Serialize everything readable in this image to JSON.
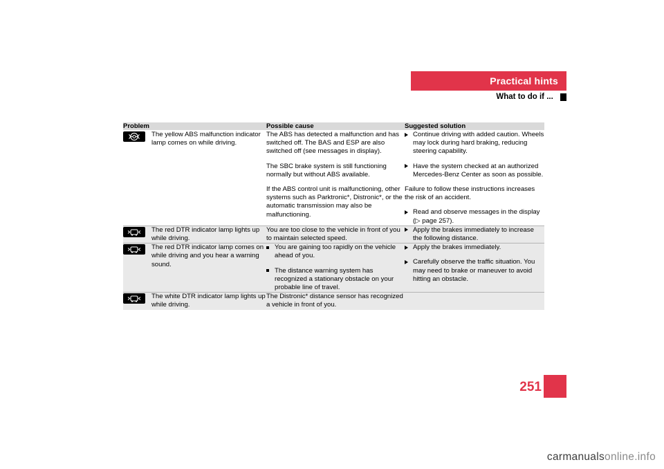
{
  "header": {
    "title": "Practical hints",
    "subtitle": "What to do if ...",
    "bar_color": "#e1344a"
  },
  "table": {
    "columns": [
      "Problem",
      "Possible cause",
      "Suggested solution"
    ],
    "rows": [
      {
        "icon": "abs-malfunction-lamp-icon",
        "problem": "The yellow ABS malfunction indicator lamp comes on while driving.",
        "cause_paragraphs": [
          "The ABS has detected a malfunction and has switched off. The BAS and ESP are also switched off (see messages in display).",
          "The SBC brake system is still functioning normally but without ABS available.",
          "If the ABS control unit is malfunctioning, other systems such as Parktronic*, Distronic*, or the automatic transmission may also be malfunctioning."
        ],
        "solution_items": [
          {
            "marker": "arrow",
            "text": "Continue driving with added caution. Wheels may lock during hard braking, reducing steering capability."
          },
          {
            "marker": "arrow",
            "text": "Have the system checked at an authorized Mercedes-Benz Center as soon as possible."
          },
          {
            "marker": "none",
            "text": "Failure to follow these instructions increases the risk of an accident."
          },
          {
            "marker": "arrow",
            "text": "Read and observe messages in the display (▷ page 257)."
          }
        ]
      },
      {
        "icon": "dtr-indicator-lamp-icon",
        "problem": "The red DTR indicator lamp lights up while driving.",
        "cause_paragraphs": [
          "You are too close to the vehicle in front of you to maintain selected speed."
        ],
        "solution_items": [
          {
            "marker": "arrow",
            "text": "Apply the brakes immediately to increase the following distance."
          }
        ]
      },
      {
        "icon": "dtr-indicator-lamp-icon",
        "problem": "The red DTR indicator lamp comes on while driving and you hear a warning sound.",
        "cause_bullets": [
          "You are gaining too rapidly on the vehicle ahead of you.",
          "The distance warning system has recognized a stationary obstacle on your probable line of travel."
        ],
        "solution_items": [
          {
            "marker": "arrow",
            "text": "Apply the brakes immediately."
          },
          {
            "marker": "arrow",
            "text": "Carefully observe the traffic situation. You may need to brake or maneuver to avoid hitting an obstacle."
          }
        ]
      },
      {
        "icon": "dtr-indicator-lamp-icon",
        "problem": "The white DTR indicator lamp lights up while driving.",
        "cause_paragraphs": [
          "The Distronic* distance sensor has recognized a vehicle in front of you."
        ],
        "solution_items": []
      }
    ]
  },
  "page": {
    "number": "251"
  },
  "watermark": {
    "name": "carmanuals",
    "domain": "online.info"
  }
}
